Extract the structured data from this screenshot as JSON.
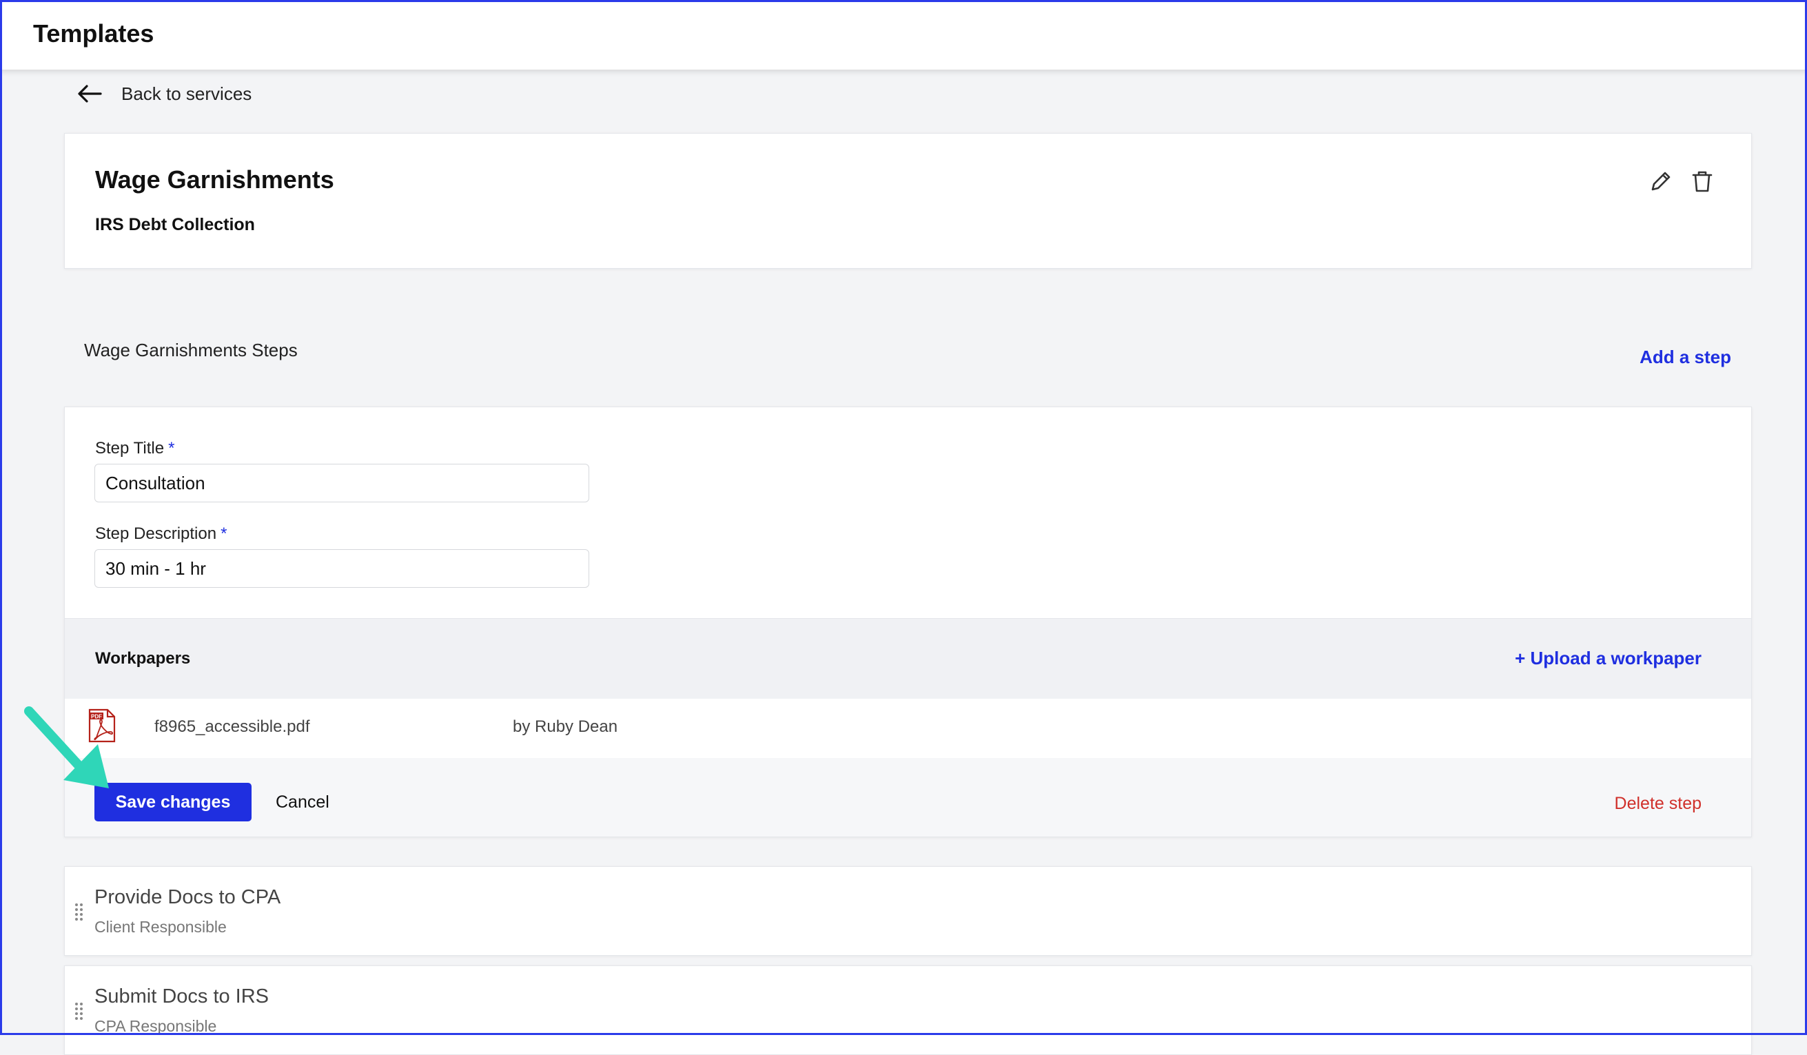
{
  "header": {
    "title": "Templates"
  },
  "nav": {
    "back_label": "Back to services"
  },
  "service": {
    "title": "Wage Garnishments",
    "subtitle": "IRS Debt Collection",
    "edit_icon": "pencil-icon",
    "delete_icon": "trash-icon"
  },
  "steps_section": {
    "heading": "Wage Garnishments Steps",
    "add_step_label": "Add a step"
  },
  "step_editor": {
    "title_label": "Step Title",
    "title_value": "Consultation",
    "description_label": "Step Description",
    "description_value": "30 min - 1 hr",
    "required_marker": "*",
    "workpapers_title": "Workpapers",
    "upload_label": "+ Upload a workpaper",
    "files": [
      {
        "name": "f8965_accessible.pdf",
        "uploaded_by": "by Ruby Dean",
        "icon": "pdf-file-icon"
      }
    ],
    "save_label": "Save changes",
    "cancel_label": "Cancel",
    "delete_label": "Delete step"
  },
  "other_steps": [
    {
      "title": "Provide Docs to CPA",
      "responsible": "Client Responsible"
    },
    {
      "title": "Submit Docs to IRS",
      "responsible": "CPA Responsible"
    }
  ],
  "colors": {
    "accent": "#1f2fe0",
    "danger": "#d0302b",
    "annotation_arrow": "#2fd6b8",
    "frame": "#2b3bea"
  }
}
